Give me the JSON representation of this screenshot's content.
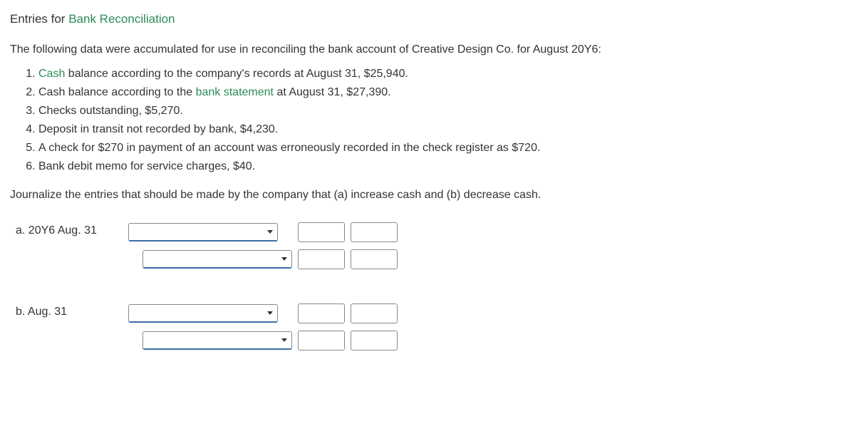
{
  "title_prefix": "Entries for ",
  "title_link": "Bank Reconciliation",
  "intro": "The following data were accumulated for use in reconciling the bank account of Creative Design Co. for August 20Y6:",
  "list_items": {
    "item1_link": "Cash",
    "item1_rest": " balance according to the company's records at August 31, $25,940.",
    "item2_pre": "Cash balance according to the ",
    "item2_link": "bank statement",
    "item2_post": " at August 31, $27,390.",
    "item3": "Checks outstanding, $5,270.",
    "item4": "Deposit in transit not recorded by bank, $4,230.",
    "item5": "A check for $270 in payment of an account was erroneously recorded in the check register as $720.",
    "item6": "Bank debit memo for service charges, $40."
  },
  "instruction": "Journalize the entries that should be made by the company that (a) increase cash and (b) decrease cash.",
  "entries": {
    "a_label": "a. 20Y6 Aug. 31",
    "b_label": "b. Aug. 31"
  },
  "inputs": {
    "a1_account": "",
    "a1_debit": "",
    "a1_credit": "",
    "a2_account": "",
    "a2_debit": "",
    "a2_credit": "",
    "b1_account": "",
    "b1_debit": "",
    "b1_credit": "",
    "b2_account": "",
    "b2_debit": "",
    "b2_credit": ""
  }
}
